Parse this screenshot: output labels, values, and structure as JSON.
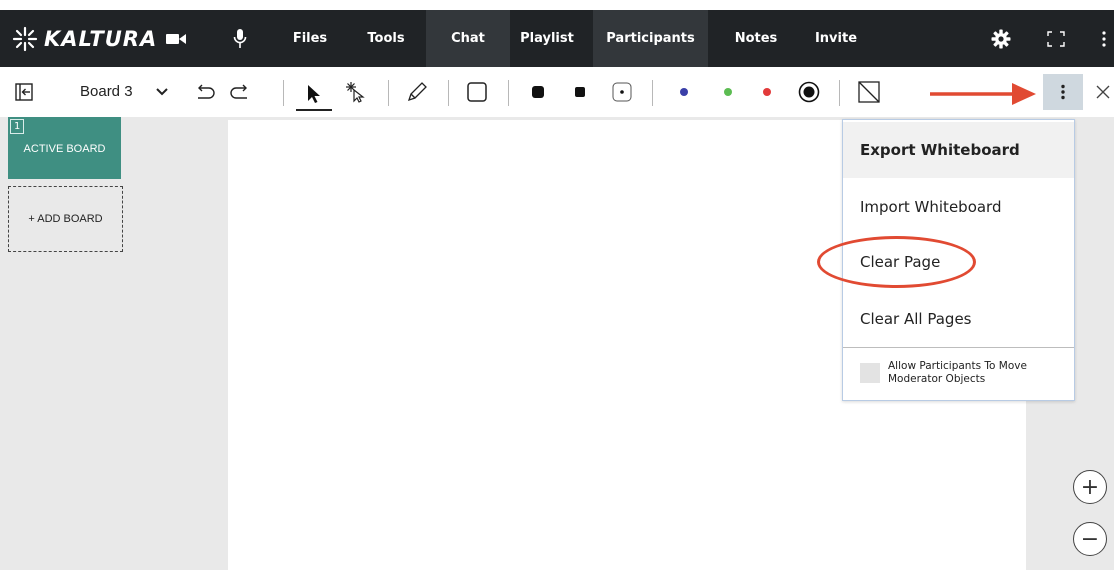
{
  "app": {
    "logo_text": "KALTURA"
  },
  "nav": {
    "tabs": [
      {
        "label": "Files"
      },
      {
        "label": "Tools"
      },
      {
        "label": "Chat"
      },
      {
        "label": "Playlist"
      },
      {
        "label": "Participants"
      },
      {
        "label": "Notes"
      },
      {
        "label": "Invite"
      }
    ],
    "icons": [
      "video-camera-icon",
      "microphone-icon",
      "settings-gear-icon",
      "fullscreen-icon",
      "more-vertical-icon"
    ]
  },
  "toolbar": {
    "board_name": "Board 3",
    "tools": [
      "collapse-panel-icon",
      "dropdown-chevron-icon",
      "undo-icon",
      "redo-icon",
      "select-pointer-icon",
      "laser-pointer-icon",
      "pencil-icon",
      "shape-square-icon",
      "stroke-large-icon",
      "stroke-medium-icon",
      "stroke-small-icon",
      "color-blue-icon",
      "color-green-icon",
      "color-red-icon",
      "color-picker-icon",
      "fill-none-icon",
      "more-options-icon",
      "close-icon"
    ],
    "colors": {
      "blue": "#3a3fa8",
      "green": "#5cbc52",
      "red": "#e23a3a",
      "more_bg": "#cfd8df"
    }
  },
  "boards": {
    "active": {
      "number": "1",
      "label": "ACTIVE BOARD"
    },
    "add_label": "+ ADD BOARD",
    "accent": "#3f8f82"
  },
  "menu": {
    "items": [
      {
        "label": "Export Whiteboard"
      },
      {
        "label": "Import Whiteboard"
      },
      {
        "label": "Clear Page"
      },
      {
        "label": "Clear All Pages"
      }
    ],
    "checkbox_label": "Allow Participants To Move Moderator Objects",
    "checkbox_checked": false
  },
  "annotations": {
    "color": "#e14a32"
  },
  "zoom": {
    "in_label": "+",
    "out_label": "−"
  }
}
